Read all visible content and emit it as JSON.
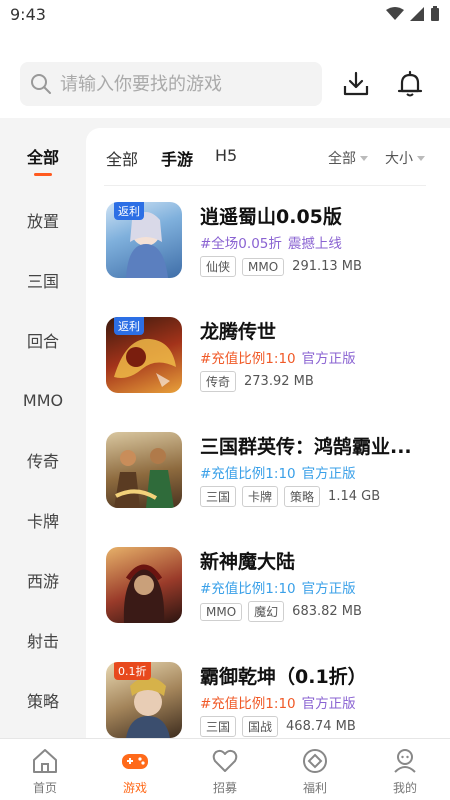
{
  "status_bar": {
    "time": "9:43"
  },
  "search": {
    "placeholder": "请输入你要找的游戏"
  },
  "sidebar": {
    "items": [
      {
        "label": "全部",
        "active": true
      },
      {
        "label": "放置"
      },
      {
        "label": "三国"
      },
      {
        "label": "回合"
      },
      {
        "label": "MMO"
      },
      {
        "label": "传奇"
      },
      {
        "label": "卡牌"
      },
      {
        "label": "西游"
      },
      {
        "label": "射击"
      },
      {
        "label": "策略"
      }
    ]
  },
  "tabs": [
    {
      "label": "全部"
    },
    {
      "label": "手游",
      "active": true
    },
    {
      "label": "H5"
    }
  ],
  "sort": {
    "filter_label": "全部",
    "size_label": "大小"
  },
  "games": [
    {
      "name": "逍遥蜀山0.05版",
      "desc_primary": "#全场0.05折",
      "desc_secondary": "震撼上线",
      "ribbon": "返利",
      "tags": [
        "仙侠",
        "MMO"
      ],
      "size": "291.13 MB",
      "colors": {
        "primary": "#8a63d2",
        "secondary": "#8a63d2"
      }
    },
    {
      "name": "龙腾传世",
      "desc_primary": "#充值比例1:10",
      "desc_secondary": "官方正版",
      "ribbon": "返利",
      "tags": [
        "传奇"
      ],
      "size": "273.92 MB",
      "colors": {
        "primary": "#f05a28",
        "secondary": "#8a63d2"
      }
    },
    {
      "name": "三国群英传：鸿鹄霸业...",
      "desc_primary": "#充值比例1:10",
      "desc_secondary": "官方正版",
      "ribbon": "",
      "tags": [
        "三国",
        "卡牌",
        "策略"
      ],
      "size": "1.14 GB",
      "colors": {
        "primary": "#3aa0e8",
        "secondary": "#3aa0e8"
      }
    },
    {
      "name": "新神魔大陆",
      "desc_primary": "#充值比例1:10",
      "desc_secondary": "官方正版",
      "ribbon": "",
      "tags": [
        "MMO",
        "魔幻"
      ],
      "size": "683.82 MB",
      "colors": {
        "primary": "#3aa0e8",
        "secondary": "#3aa0e8"
      }
    },
    {
      "name": "霸御乾坤（0.1折）",
      "desc_primary": "#充值比例1:10",
      "desc_secondary": "官方正版",
      "ribbon": "0.1折",
      "tags": [
        "三国",
        "国战"
      ],
      "size": "468.74 MB",
      "colors": {
        "primary": "#f05a28",
        "secondary": "#8a63d2"
      }
    }
  ],
  "bottom_nav": [
    {
      "label": "首页",
      "icon": "home-icon"
    },
    {
      "label": "游戏",
      "icon": "gamepad-icon",
      "active": true
    },
    {
      "label": "招募",
      "icon": "heart-icon"
    },
    {
      "label": "福利",
      "icon": "diamond-icon"
    },
    {
      "label": "我的",
      "icon": "profile-icon"
    }
  ],
  "colors": {
    "accent": "#ff6a1a",
    "inactive": "#777777"
  }
}
